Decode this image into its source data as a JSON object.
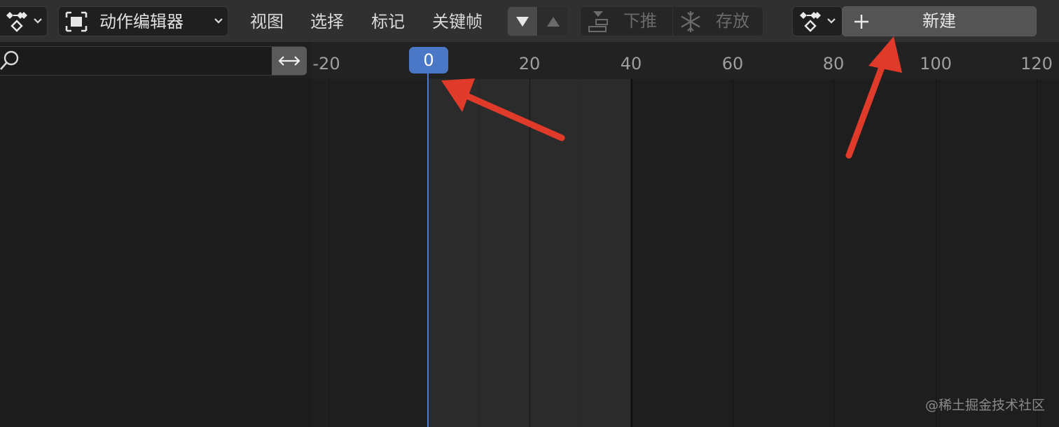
{
  "header": {
    "editor_type": {
      "label": "动作编辑器",
      "icon": "action-editor-icon"
    },
    "menus": [
      "视图",
      "选择",
      "标记",
      "关键帧"
    ],
    "keyframe_nav": {
      "down_icon": "triangle-down-icon",
      "up_icon": "triangle-up-icon"
    },
    "push_down": {
      "label": "下推",
      "icon": "push-down-icon"
    },
    "stash": {
      "label": "存放",
      "icon": "snowflake-icon"
    },
    "action": {
      "new_label": "新建",
      "new_icon": "plus-icon",
      "selector_icon": "keyframe-mode-icon"
    }
  },
  "channel_region": {
    "search_icon": "search-icon",
    "swap_icon": "swap-horizontal-icon"
  },
  "timeline": {
    "ruler_labels": [
      "-20",
      "0",
      "20",
      "40",
      "60",
      "80",
      "100",
      "120"
    ],
    "current_frame": "0",
    "accent_color": "#4a78c6"
  },
  "annotations": {
    "arrow_color": "#e03a2a",
    "count": 2
  },
  "watermark": "@稀土掘金技术社区"
}
